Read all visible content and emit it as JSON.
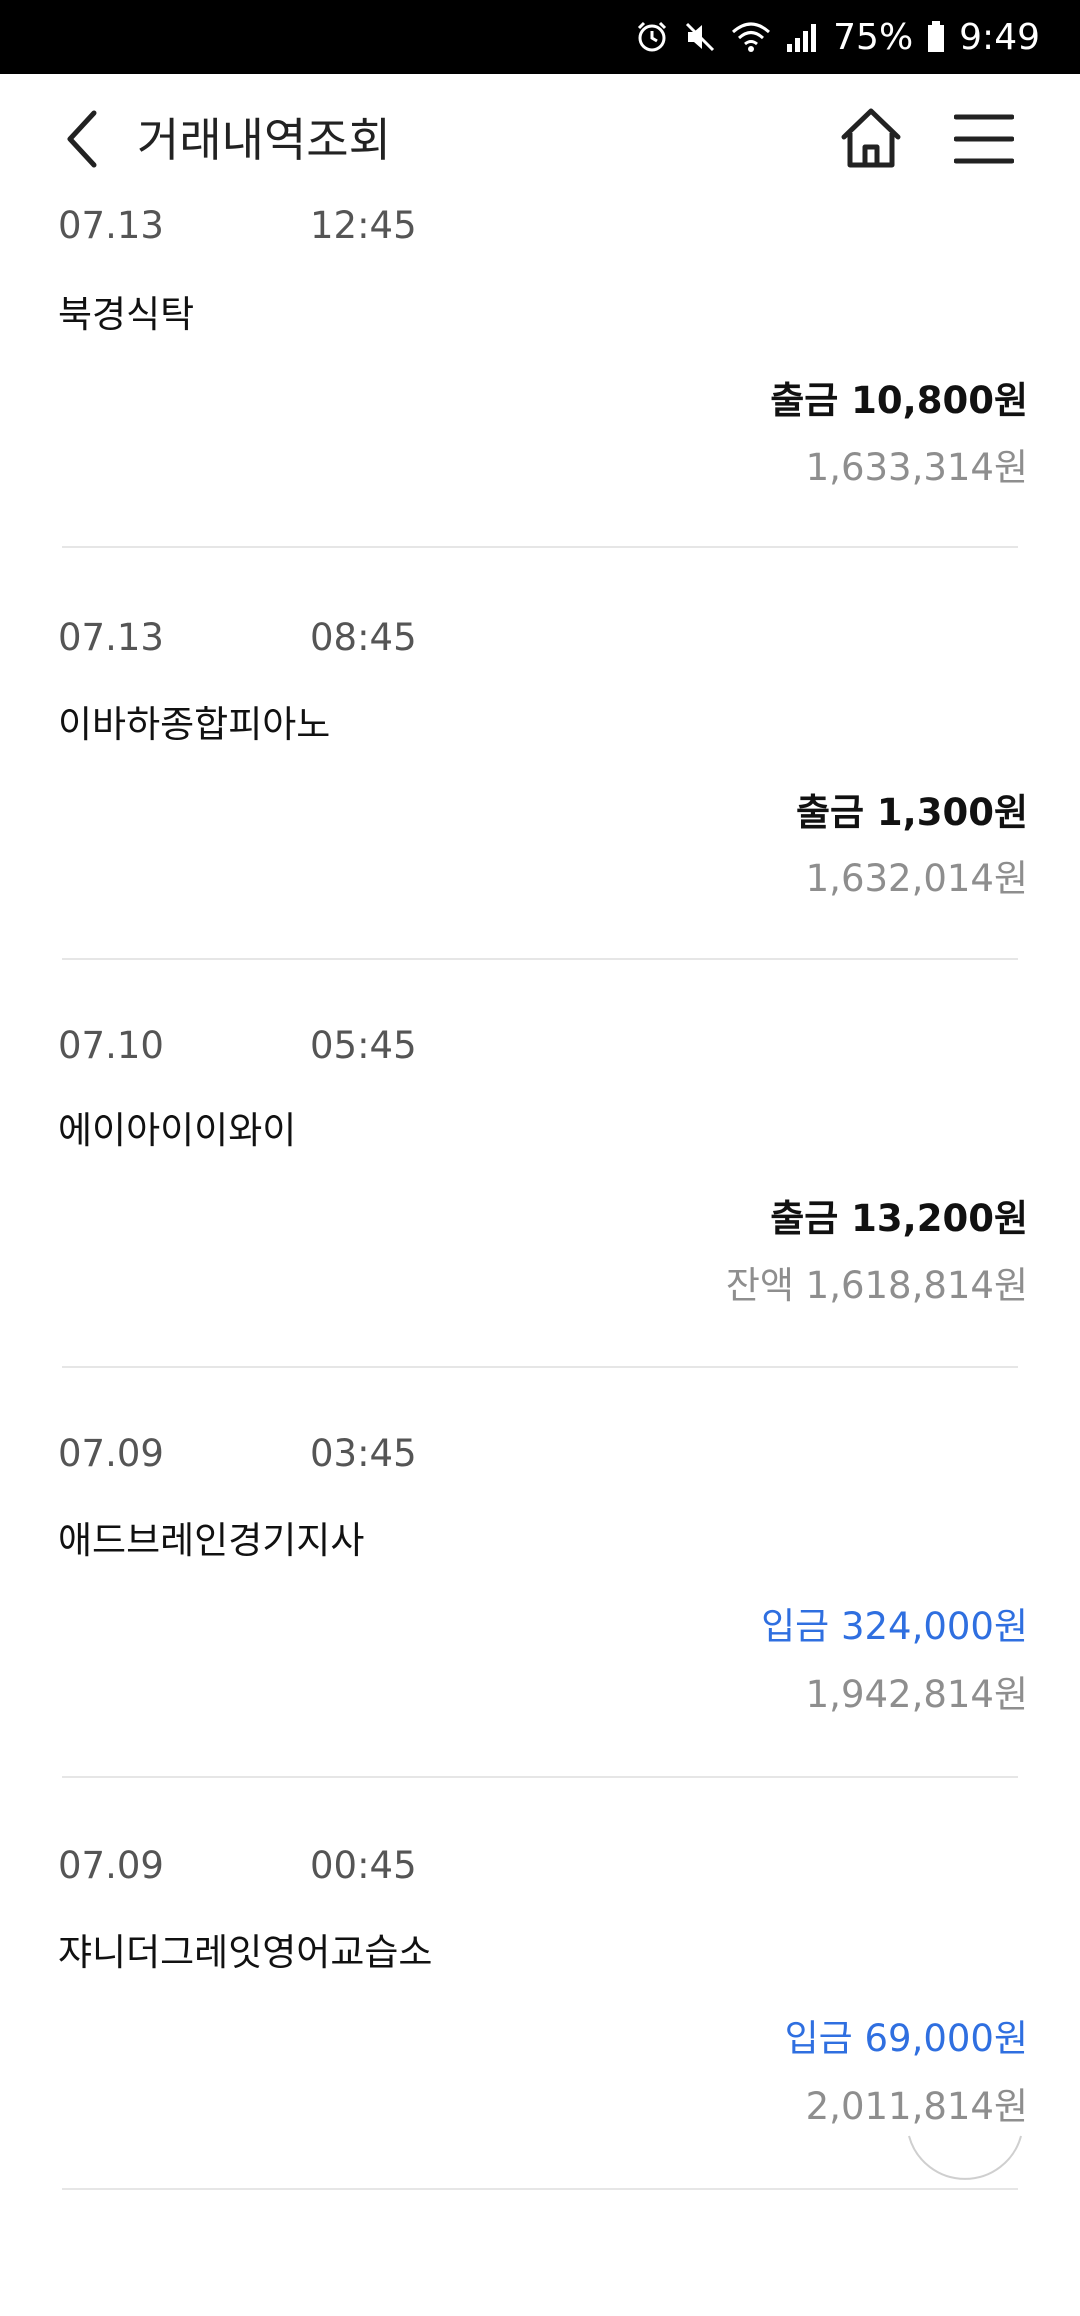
{
  "status_bar": {
    "battery": "75%",
    "time": "9:49",
    "icons": [
      "alarm-icon",
      "mute-icon",
      "wifi-icon",
      "signal-icon",
      "battery-icon"
    ]
  },
  "header": {
    "title": "거래내역조회",
    "icons": [
      "back-icon",
      "home-icon",
      "menu-icon"
    ]
  },
  "transactions": [
    {
      "date": "07.13",
      "time": "12:45",
      "merchant": "북경식탁",
      "amount": "출금 10,800원",
      "balance": "1,633,314원",
      "type": "withdrawal"
    },
    {
      "date": "07.13",
      "time": "08:45",
      "merchant": "이바하종합피아노",
      "amount": "출금 1,300원",
      "balance": "1,632,014원",
      "type": "withdrawal"
    },
    {
      "date": "07.10",
      "time": "05:45",
      "merchant": "에이아이이와이",
      "amount": "출금 13,200원",
      "balance": "잔액 1,618,814원",
      "type": "withdrawal"
    },
    {
      "date": "07.09",
      "time": "03:45",
      "merchant": "애드브레인경기지사",
      "amount": "입금 324,000원",
      "balance": "1,942,814원",
      "type": "deposit"
    },
    {
      "date": "07.09",
      "time": "00:45",
      "merchant": "쟈니더그레잇영어교습소",
      "amount": "입금 69,000원",
      "balance": "2,011,814원",
      "type": "deposit"
    }
  ],
  "colors": {
    "deposit": "#2f6fe0",
    "withdrawal": "#111111",
    "balance": "#8e8e8e",
    "statusbar": "#000000"
  }
}
